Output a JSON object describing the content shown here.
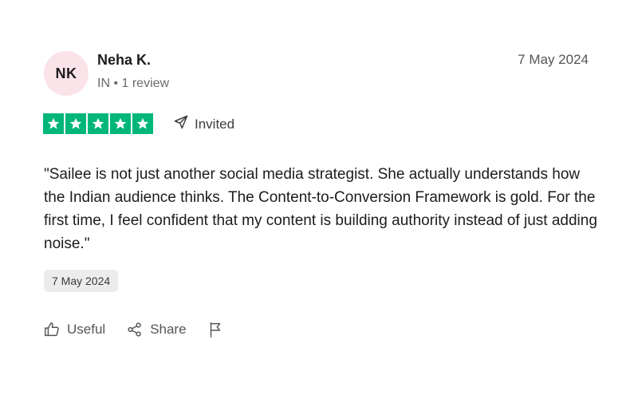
{
  "reviewer": {
    "initials": "NK",
    "name": "Neha K.",
    "country": "IN",
    "review_count": "1 review",
    "avatar_bg": "#fbe3ea"
  },
  "review": {
    "date": "7 May 2024",
    "rating": 5,
    "rating_max": 5,
    "star_color": "#00b67a",
    "invited_label": "Invited",
    "text": "\"Sailee is not just another social media strategist. She actually understands how the Indian audience thinks. The Content-to-Conversion Framework is gold. For the first time, I feel confident that my content is building authority instead of just adding noise.\"",
    "date_of_experience": "7 May 2024"
  },
  "actions": {
    "useful_label": "Useful",
    "share_label": "Share",
    "report_icon": "flag-icon"
  }
}
